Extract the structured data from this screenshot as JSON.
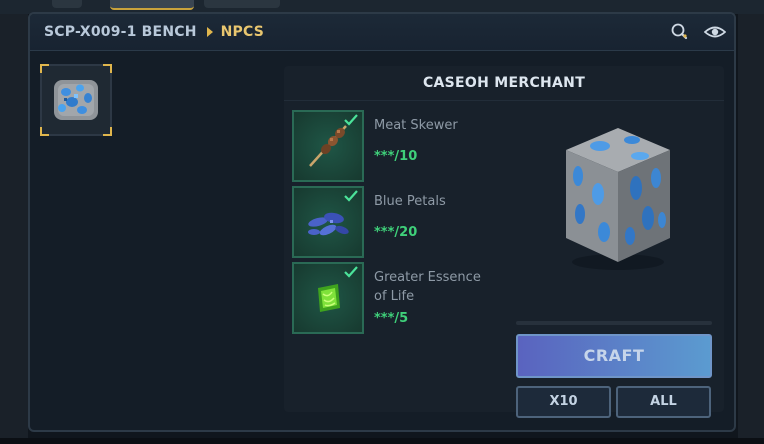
{
  "breadcrumb": {
    "root": "SCP-X009-1 BENCH",
    "current": "NPCS"
  },
  "header_icons": [
    "search-icon",
    "eye-icon"
  ],
  "selected_item": {
    "icon": "blue-spotted-ore-block-icon"
  },
  "recipe": {
    "title": "CASEOH MERCHANT",
    "ingredients": [
      {
        "name": "Meat Skewer",
        "quantity": "***/10",
        "icon": "meat-skewer-icon",
        "has_enough": true
      },
      {
        "name": "Blue Petals",
        "quantity": "***/20",
        "icon": "blue-petals-icon",
        "has_enough": true
      },
      {
        "name": "Greater Essence of Life",
        "quantity": "***/5",
        "icon": "essence-of-life-icon",
        "has_enough": true
      }
    ],
    "output_icon": "blue-spotted-ore-block-icon",
    "craft_progress": 0,
    "buttons": {
      "craft": "CRAFT",
      "x10": "X10",
      "all": "ALL"
    }
  },
  "colors": {
    "accent_gold": "#e0b64d",
    "quantity_green": "#3fd07a",
    "craft_button": "#5b82c8"
  }
}
